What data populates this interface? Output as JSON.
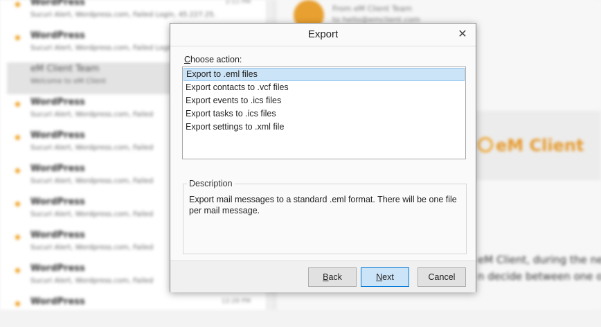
{
  "background": {
    "mail_list": [
      {
        "sender": "WordPress",
        "preview": "Sucuri Alert, Wordpress.com, Failed Login, 45.227.25.",
        "time": "2:11 PM",
        "unread": true
      },
      {
        "sender": "WordPress",
        "preview": "Sucuri Alert, Wordpress.com, Failed Login",
        "time": "",
        "unread": true
      },
      {
        "sender": "eM Client Team",
        "preview": "Welcome to eM Client",
        "time": "",
        "unread": false
      },
      {
        "sender": "WordPress",
        "preview": "Sucuri Alert, Wordpress.com, Failed",
        "time": "",
        "unread": true
      },
      {
        "sender": "WordPress",
        "preview": "Sucuri Alert, Wordpress.com, Failed",
        "time": "",
        "unread": true
      },
      {
        "sender": "WordPress",
        "preview": "Sucuri Alert, Wordpress.com, Failed",
        "time": "",
        "unread": true
      },
      {
        "sender": "WordPress",
        "preview": "Sucuri Alert, Wordpress.com, Failed",
        "time": "",
        "unread": true
      },
      {
        "sender": "WordPress",
        "preview": "Sucuri Alert, Wordpress.com, Failed",
        "time": "",
        "unread": true
      },
      {
        "sender": "WordPress",
        "preview": "Sucuri Alert, Wordpress.com, Failed",
        "time": "",
        "unread": true
      },
      {
        "sender": "WordPress",
        "preview": "",
        "time": "12:28 PM",
        "unread": true
      }
    ],
    "reading": {
      "from": "From eM Client Team",
      "to": "to hello@emclient.com",
      "logo_text": "eM Client",
      "body_line1": "eM Client, during the ne",
      "body_line2": "n decide between one o"
    },
    "accent_color": "#f0a020"
  },
  "dialog": {
    "title": "Export",
    "close_icon": "close-icon",
    "choose_label_prefix": "C",
    "choose_label_rest": "hoose action:",
    "actions": [
      "Export to .eml files",
      "Export contacts to .vcf files",
      "Export events to .ics files",
      "Export tasks to .ics files",
      "Export settings to .xml file"
    ],
    "selected_action_index": 0,
    "description_legend": "Description",
    "description_text": "Export mail messages to a standard .eml format. There will be one file per mail message.",
    "buttons": {
      "back_mnemonic": "B",
      "back_rest": "ack",
      "next_mnemonic": "N",
      "next_rest": "ext",
      "cancel": "Cancel"
    },
    "selection_color": "#cce4f7",
    "primary_border_color": "#0078d7"
  }
}
